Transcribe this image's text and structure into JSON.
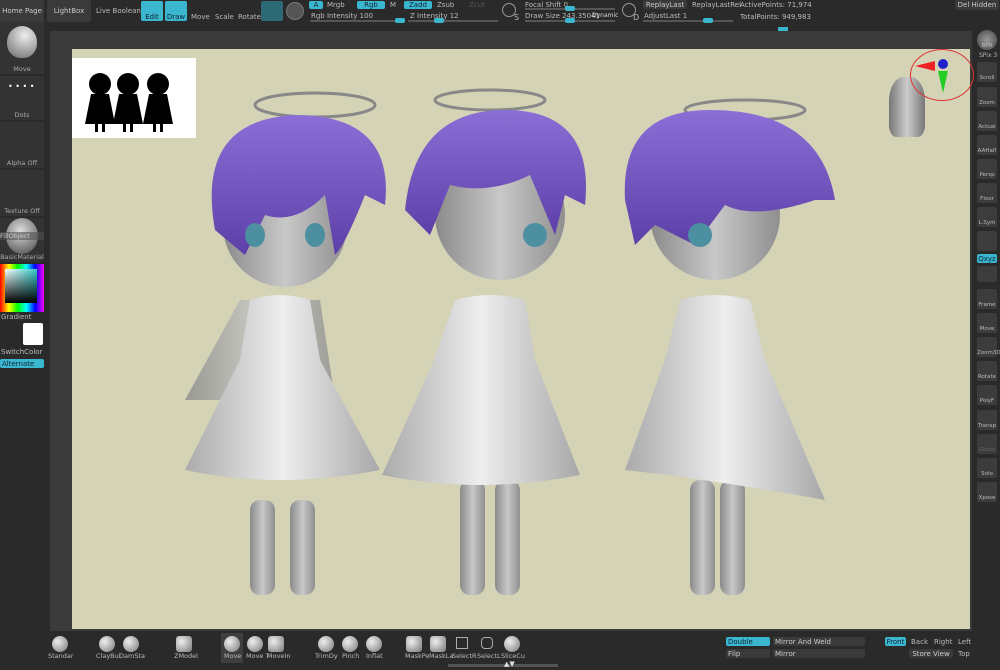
{
  "top": {
    "home_page": "Home Page",
    "lightbox": "LightBox",
    "live_boolean": "Live Boolean",
    "edit": "Edit",
    "draw": "Draw",
    "move": "Move",
    "scale": "Scale",
    "rotate": "Rotate",
    "a": "A",
    "mrgb": "Mrgb",
    "rgb": "Rgb",
    "m": "M",
    "zadd": "Zadd",
    "zsub": "Zsub",
    "zcut": "Zcut",
    "rgb_intensity": "Rgb Intensity 100",
    "z_intensity": "Z Intensity 12",
    "focal_shift": "Focal Shift 0",
    "draw_size": "Draw Size 243.35041",
    "dynamic": "Dynamic",
    "s": "S",
    "d": "D",
    "replay_last": "ReplayLast",
    "replay_last_rel": "ReplayLastRel",
    "adjust_last": "AdjustLast 1",
    "active_points": "ActivePoints: 71,974",
    "total_points": "TotalPoints: 949,983",
    "del_hidden": "Del Hidden",
    "rgb_intensity_value": 100,
    "z_intensity_value": 12
  },
  "left": {
    "brush": "Move",
    "stroke": "Dots",
    "alpha": "Alpha Off",
    "texture": "Texture Off",
    "fill_object": "FillObject",
    "material": "BasicMaterial",
    "gradient": "Gradient",
    "switch_color": "SwitchColor",
    "alternate": "Alternate"
  },
  "right": [
    "BPR",
    "SPix 3",
    "Scroll",
    "Zoom",
    "Actual",
    "AAHalf",
    "Persp",
    "Floor",
    "L.Sym",
    "",
    "Qxyz",
    "",
    "Frame",
    "Move",
    "Zoom3D",
    "Rotate",
    "PolyF",
    "Transp",
    "Ghost",
    "Solo",
    "Xpose"
  ],
  "bottom": {
    "brushes": [
      "Standar",
      "ClayBui",
      "DamSta",
      "ZModel",
      "Move",
      "Move T",
      "MoveIn",
      "TrimDy",
      "Pinch",
      "Inflat",
      "MaskPe",
      "MaskLa",
      "SelectR",
      "SelectL",
      "SliceCu"
    ],
    "double": "Double",
    "flip": "Flip",
    "mirror_weld": "Mirror And Weld",
    "mirror": "Mirror",
    "front": "Front",
    "back": "Back",
    "right": "Right",
    "left": "Left",
    "store_view": "Store View",
    "top": "Top"
  },
  "colors": {
    "accent": "#3ab7cf",
    "canvas": "#d5d3b6",
    "hair": "#7b5cc8",
    "dress": "#e6e6e6"
  }
}
